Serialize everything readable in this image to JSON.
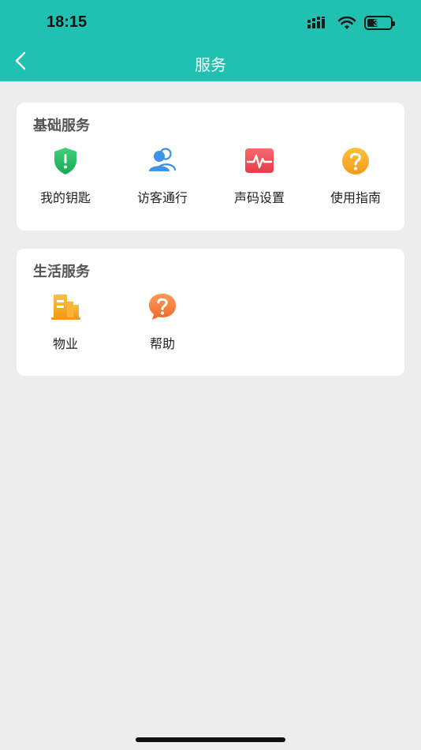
{
  "status_bar": {
    "time": "18:15",
    "battery": "31"
  },
  "nav": {
    "title": "服务"
  },
  "sections": [
    {
      "title": "基础服务",
      "items": [
        {
          "label": "我的钥匙",
          "icon": "shield-key-icon",
          "color": "#2bbf6a"
        },
        {
          "label": "访客通行",
          "icon": "visitor-users-icon",
          "color": "#3a8ee6"
        },
        {
          "label": "声码设置",
          "icon": "heartbeat-wave-icon",
          "color": "#f0505a"
        },
        {
          "label": "使用指南",
          "icon": "question-circle-icon",
          "color": "#f5a623"
        }
      ]
    },
    {
      "title": "生活服务",
      "items": [
        {
          "label": "物业",
          "icon": "building-icon",
          "color": "#f5a623"
        },
        {
          "label": "帮助",
          "icon": "help-bubble-icon",
          "color": "#f07d3c"
        }
      ]
    }
  ]
}
